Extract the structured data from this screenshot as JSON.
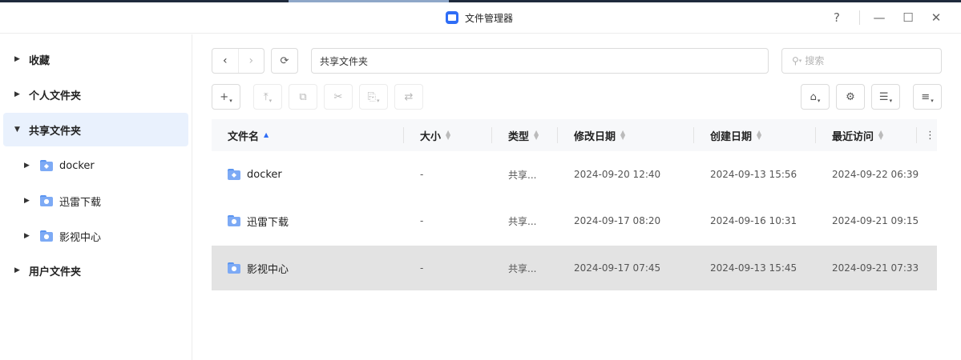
{
  "window": {
    "title": "文件管理器",
    "help_label": "?",
    "minimize_label": "—",
    "maximize_label": "☐",
    "close_label": "✕"
  },
  "sidebar": {
    "items": [
      {
        "label": "收藏",
        "expanded": false
      },
      {
        "label": "个人文件夹",
        "expanded": false
      },
      {
        "label": "共享文件夹",
        "expanded": true,
        "selected": true
      },
      {
        "label": "用户文件夹",
        "expanded": false
      }
    ],
    "children": [
      {
        "label": "docker",
        "icon": "docker-folder-icon"
      },
      {
        "label": "迅雷下载",
        "icon": "shared-folder-icon"
      },
      {
        "label": "影视中心",
        "icon": "shared-folder-icon"
      }
    ]
  },
  "toolbar": {
    "path": "共享文件夹",
    "search_placeholder": "搜索",
    "icons": {
      "back": "‹",
      "forward": "›",
      "refresh": "⟳",
      "new": "+",
      "upload": "⤒",
      "copy": "⧉",
      "cut": "✂",
      "paste": "⎘",
      "move": "⇄",
      "share": "⌂",
      "settings": "⚙",
      "view": "☰",
      "sort": "≡"
    }
  },
  "table": {
    "columns": [
      "文件名",
      "大小",
      "类型",
      "修改日期",
      "创建日期",
      "最近访问"
    ],
    "more_icon": "⋮",
    "rows": [
      {
        "name": "docker",
        "size": "-",
        "type": "共享...",
        "modified": "2024-09-20 12:40",
        "created": "2024-09-13 15:56",
        "accessed": "2024-09-22 06:39",
        "selected": false,
        "icon": "docker-folder-icon"
      },
      {
        "name": "迅雷下载",
        "size": "-",
        "type": "共享...",
        "modified": "2024-09-17 08:20",
        "created": "2024-09-16 10:31",
        "accessed": "2024-09-21 09:15",
        "selected": false,
        "icon": "shared-folder-icon"
      },
      {
        "name": "影视中心",
        "size": "-",
        "type": "共享...",
        "modified": "2024-09-17 07:45",
        "created": "2024-09-13 15:45",
        "accessed": "2024-09-21 07:33",
        "selected": true,
        "icon": "shared-folder-icon"
      }
    ]
  },
  "colors": {
    "accent": "#2f6df6",
    "selected_sidebar": "#e9f1fd",
    "selected_row": "#e3e3e3",
    "folder": "#7daaf5"
  }
}
